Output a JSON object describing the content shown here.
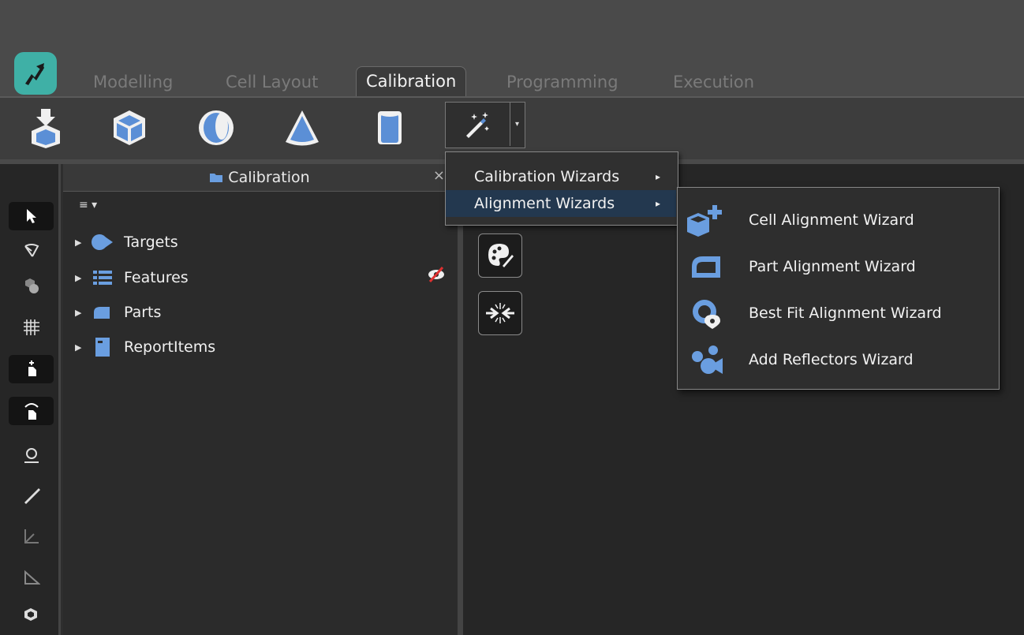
{
  "tabs": [
    {
      "label": "Modelling",
      "active": false
    },
    {
      "label": "Cell Layout",
      "active": false
    },
    {
      "label": "Calibration",
      "active": true
    },
    {
      "label": "Programming",
      "active": false
    },
    {
      "label": "Execution",
      "active": false
    }
  ],
  "panel": {
    "title": "Calibration",
    "close_glyph": "×",
    "view_menu": "≡ ▾",
    "tree": [
      {
        "label": "Targets",
        "icon": "target-icon"
      },
      {
        "label": "Features",
        "icon": "features-list-icon"
      },
      {
        "label": "Parts",
        "icon": "part-icon"
      },
      {
        "label": "ReportItems",
        "icon": "report-icon"
      }
    ]
  },
  "wizard_menu": {
    "items": [
      {
        "label": "Calibration Wizards",
        "arrow": "▸",
        "highlighted": false
      },
      {
        "label": "Alignment Wizards",
        "arrow": "▸",
        "highlighted": true
      }
    ]
  },
  "alignment_submenu": {
    "items": [
      {
        "label": "Cell Alignment Wizard",
        "icon": "cell-alignment-icon"
      },
      {
        "label": "Part Alignment Wizard",
        "icon": "part-alignment-icon"
      },
      {
        "label": "Best Fit Alignment Wizard",
        "icon": "best-fit-icon"
      },
      {
        "label": "Add Reflectors Wizard",
        "icon": "reflectors-icon"
      }
    ]
  },
  "colors": {
    "accent": "#5b8fd6",
    "highlight": "#23384f",
    "logo": "#3fb0a6"
  }
}
